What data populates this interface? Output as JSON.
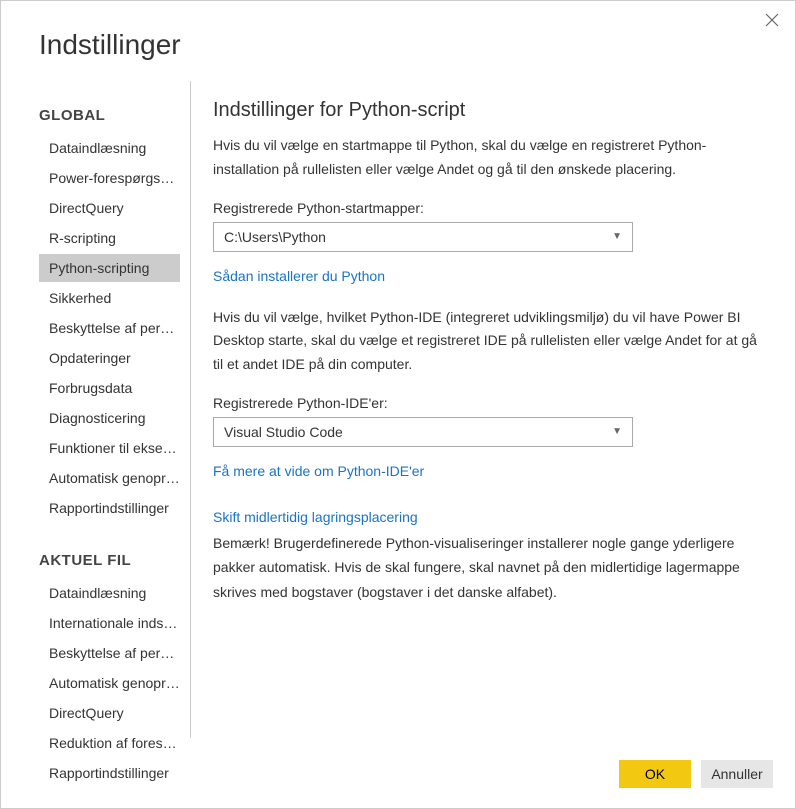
{
  "dialog": {
    "title": "Indstillinger"
  },
  "sidebar": {
    "global_label": "GLOBAL",
    "global_items": [
      "Dataindlæsning",
      "Power-forespørgse…",
      "DirectQuery",
      "R-scripting",
      "Python-scripting",
      "Sikkerhed",
      "Beskyttelse af perso…",
      "Opdateringer",
      "Forbrugsdata",
      "Diagnosticering",
      "Funktioner til eksem…",
      "Automatisk genopr…",
      "Rapportindstillinger"
    ],
    "global_selected_index": 4,
    "local_label": "AKTUEL FIL",
    "local_items": [
      "Dataindlæsning",
      "Internationale inds…",
      "Beskyttelse af pers…",
      "Automatisk genopr…",
      "DirectQuery",
      "Reduktion af foresp…",
      "Rapportindstillinger"
    ]
  },
  "content": {
    "title": "Indstillinger for Python-script",
    "para1": "Hvis du vil vælge en startmappe til Python, skal du vælge en registreret Python-installation på rullelisten eller vælge Andet og gå til den ønskede placering.",
    "homedirs_label": "Registrerede Python-startmapper:",
    "homedirs_value": "C:\\Users\\Python",
    "install_link": "Sådan installerer du Python",
    "para2": "Hvis du vil vælge, hvilket Python-IDE (integreret udviklingsmiljø) du vil have Power BI Desktop starte, skal du vælge et registreret IDE på rullelisten eller vælge Andet for at gå til et andet IDE på din computer.",
    "ides_label": "Registrerede Python-IDE'er:",
    "ides_value": "Visual Studio Code",
    "ide_link": "Få mere at vide om Python-IDE'er",
    "storage_link": "Skift midlertidig lagringsplacering",
    "note": "Bemærk! Brugerdefinerede Python-visualiseringer installerer nogle gange yderligere pakker automatisk. Hvis de skal fungere, skal navnet på den midlertidige lagermappe skrives med bogstaver (bogstaver i det danske alfabet)."
  },
  "footer": {
    "ok": "OK",
    "cancel": "Annuller"
  }
}
